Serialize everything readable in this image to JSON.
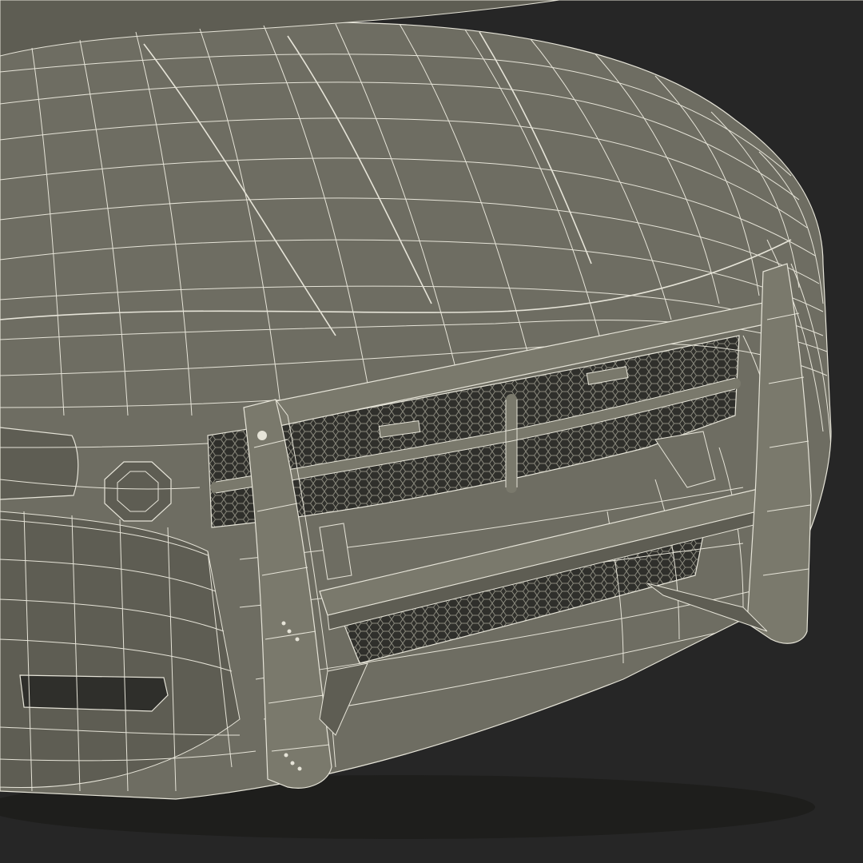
{
  "scene": {
    "subject": "wireframe-police-car-front",
    "colors": {
      "background": "#262626",
      "body": "#6e6d62",
      "body_dark": "#5e5d53",
      "body_light": "#7a796c",
      "wire": "#e6e4d8",
      "grille_dark": "#2f2f2b",
      "grille_mesh": "#8b8a7e",
      "shadow": "#1e1e1c"
    }
  }
}
